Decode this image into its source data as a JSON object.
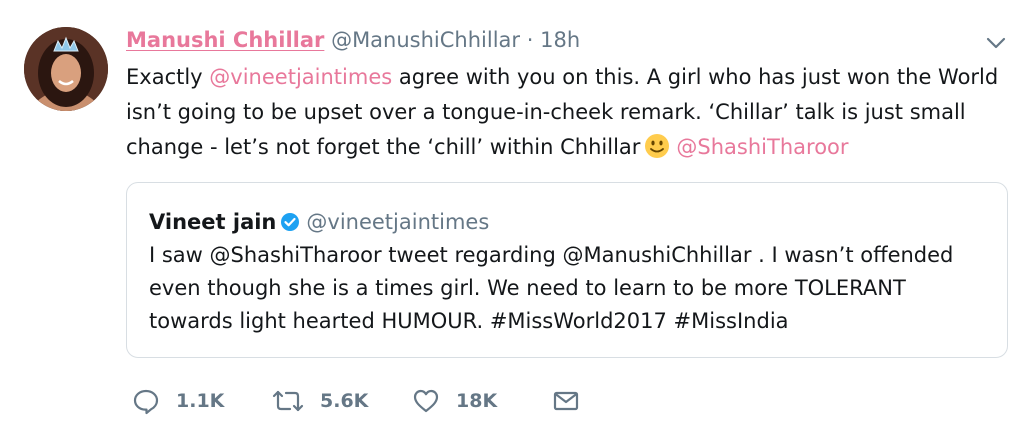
{
  "tweet": {
    "display_name": "Manushi Chhillar",
    "handle": "@ManushiChhillar",
    "separator": "·",
    "time": "18h",
    "text_parts": {
      "p1": "Exactly ",
      "m1": "@vineetjaintimes",
      "p2": " agree with you on this. A girl who has just won the World isn’t going to be upset over a tongue-in-cheek remark. ‘Chillar’ talk is just small change - let’s not forget the ‘chill’ within Chhillar",
      "m2": "@ShashiTharoor"
    }
  },
  "quoted_tweet": {
    "display_name": "Vineet jain",
    "handle": "@vineetjaintimes",
    "text": "I saw @ShashiTharoor tweet regarding @ManushiChhillar . I wasn’t offended even though she is a times girl. We need to learn to be more TOLERANT towards light hearted HUMOUR. #MissWorld2017 #MissIndia"
  },
  "actions": {
    "replies": "1.1K",
    "retweets": "5.6K",
    "likes": "18K"
  },
  "colors": {
    "link": "#e8789b",
    "secondary": "#657786",
    "verified": "#1da1f2"
  },
  "icons": [
    "chevron-down-icon",
    "reply-icon",
    "retweet-icon",
    "like-icon",
    "direct-message-icon",
    "verified-badge-icon",
    "slightly-smiling-face-emoji"
  ]
}
